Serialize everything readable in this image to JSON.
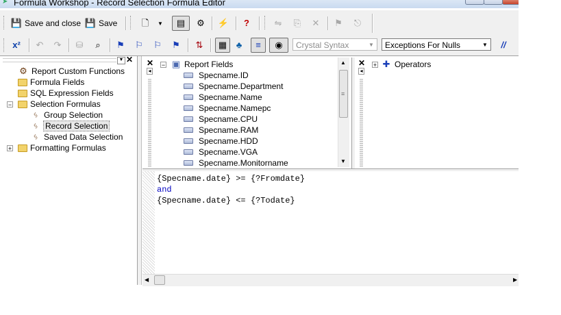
{
  "window": {
    "title": "Formula Workshop - Record Selection Formula Editor"
  },
  "toolbar1": {
    "save_close_label": "Save and close",
    "save_label": "Save"
  },
  "toolbar2": {
    "syntax_combo": "Crystal Syntax",
    "nulls_combo": "Exceptions For Nulls"
  },
  "workshop_tree": {
    "items": [
      {
        "label": "Report Custom Functions"
      },
      {
        "label": "Formula Fields"
      },
      {
        "label": "SQL Expression Fields"
      },
      {
        "label": "Selection Formulas"
      },
      {
        "label": "Group Selection"
      },
      {
        "label": "Record Selection"
      },
      {
        "label": "Saved Data Selection"
      },
      {
        "label": "Formatting Formulas"
      }
    ]
  },
  "fields_tree": {
    "root": "Report Fields",
    "fields": [
      "Specname.ID",
      "Specname.Department",
      "Specname.Name",
      "Specname.Namepc",
      "Specname.CPU",
      "Specname.RAM",
      "Specname.HDD",
      "Specname.VGA",
      "Specname.Monitorname"
    ]
  },
  "operators_tree": {
    "root": "Operators"
  },
  "editor": {
    "lines": [
      "{Specname.date} >= {?Fromdate}",
      "and",
      "{Specname.date} <= {?Todate}"
    ]
  },
  "colors": {
    "keyword": "#0000c0",
    "selection": "#e8e8e8",
    "toolbar_bg": "#f0f0f0"
  }
}
